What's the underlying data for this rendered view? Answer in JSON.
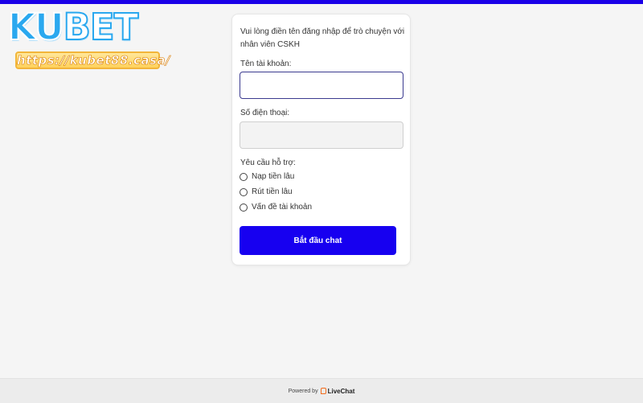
{
  "logo": {
    "brand_left": "KU",
    "brand_right": "BET",
    "url_text": "https://kubet88.casa/",
    "colors": {
      "ku": "#2aa8ef",
      "url_bg": "#ffd25c"
    }
  },
  "form": {
    "intro": "Vui lòng điền tên đăng nhập để trò chuyện với nhân viên CSKH",
    "username_label": "Tên tài khoản:",
    "username_value": "",
    "phone_label": "Số điện thoại:",
    "phone_value": "",
    "support_label": "Yêu cầu hỗ trợ:",
    "options": [
      {
        "label": "Nạp tiền lâu"
      },
      {
        "label": "Rút tiền lâu"
      },
      {
        "label": "Vấn đề tài khoản"
      }
    ],
    "submit_label": "Bắt đầu chat"
  },
  "footer": {
    "powered_by": "Powered by",
    "brand": "LiveChat",
    "brand_icon": "livechat-icon"
  },
  "colors": {
    "accent": "#1700f0",
    "top_bar": "#1a00e8"
  }
}
